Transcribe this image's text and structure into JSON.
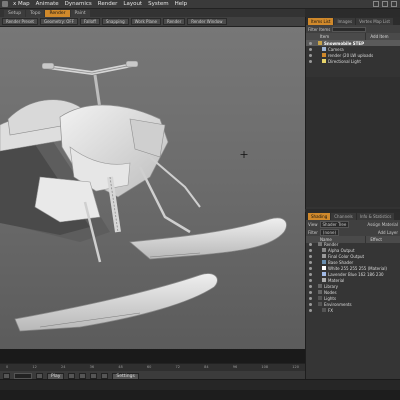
{
  "menubar": {
    "items": [
      "x Map",
      "Animate",
      "Dynamics",
      "Render",
      "Layout",
      "System",
      "Help"
    ]
  },
  "tabs": {
    "items": [
      {
        "label": "Setup",
        "active": false
      },
      {
        "label": "Topo",
        "active": false
      },
      {
        "label": "Render",
        "active": true
      },
      {
        "label": "Paint",
        "active": false
      }
    ]
  },
  "toolbar": {
    "buttons": [
      "Render Preset",
      "Geometry: OFF",
      "Falloff",
      "Snapping",
      "Work Plane",
      "Render",
      "Render Window"
    ]
  },
  "timeline": {
    "ticks": [
      "0",
      "12",
      "24",
      "36",
      "48",
      "60",
      "72",
      "84",
      "96",
      "108",
      "120"
    ],
    "play_label": "Play",
    "settings_label": "Settings"
  },
  "top_panel": {
    "tabs": [
      {
        "label": "Items List",
        "active": true
      },
      {
        "label": "Images",
        "active": false
      },
      {
        "label": "Vertex Map List",
        "active": false
      }
    ],
    "filter_label": "Filter Items",
    "col_name": "Item",
    "col_other": "Add Item",
    "items": [
      {
        "label": "Snowmobile STEP",
        "indent": 1,
        "selected": true,
        "color": "#c8a34a",
        "visible": true
      },
      {
        "label": "Camera",
        "indent": 2,
        "selected": false,
        "color": "#9fb6d6",
        "visible": true
      },
      {
        "label": "render (20 LW uploads",
        "indent": 2,
        "selected": false,
        "color": "#d0892b",
        "visible": true
      },
      {
        "label": "Directional Light",
        "indent": 2,
        "selected": false,
        "color": "#e7d46a",
        "visible": true
      }
    ]
  },
  "bottom_panel": {
    "tabs": [
      {
        "label": "Shading",
        "active": true
      },
      {
        "label": "Channels",
        "active": false
      },
      {
        "label": "Info & Statistics",
        "active": false
      }
    ],
    "view_label": "View",
    "view_value": "Shader Tree",
    "filter_label": "Filter",
    "filter_value": "(none)",
    "assign_label": "Assign Material",
    "add_label": "Add Layer",
    "col_name": "Name",
    "col_effect": "Effect",
    "rows": [
      {
        "label": "Render",
        "indent": 1,
        "color": "#777777"
      },
      {
        "label": "Alpha Output",
        "indent": 2,
        "color": "#888888"
      },
      {
        "label": "Final Color Output",
        "indent": 2,
        "color": "#999999"
      },
      {
        "label": "Base Shader",
        "indent": 2,
        "color": "#6a8fb0"
      },
      {
        "label": "White 255 255 255 (Material)",
        "indent": 2,
        "color": "#ffffff"
      },
      {
        "label": "Lavender Blue 162 186 230",
        "indent": 2,
        "color": "#a2bae6"
      },
      {
        "label": "Material",
        "indent": 2,
        "color": "#b0b0b0"
      },
      {
        "label": "Library",
        "indent": 1,
        "color": "#666666"
      },
      {
        "label": "Nodes",
        "indent": 1,
        "color": "#666666"
      },
      {
        "label": "Lights",
        "indent": 1,
        "color": "#555555"
      },
      {
        "label": "Environments",
        "indent": 1,
        "color": "#555555"
      },
      {
        "label": "FX",
        "indent": 2,
        "color": "#555555"
      }
    ]
  }
}
